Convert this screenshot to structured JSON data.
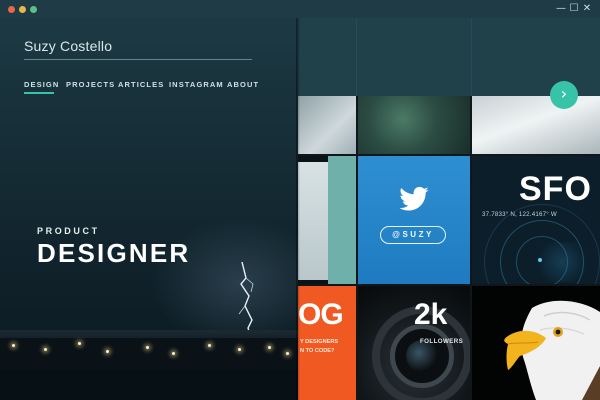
{
  "window": {
    "controls": {
      "minimize": "—",
      "maximize": "☐",
      "close": "✕"
    }
  },
  "header": {
    "name": "Suzy Costello",
    "nav": [
      {
        "label": "DESIGN",
        "active": true
      },
      {
        "label": "PROJECTS",
        "active": false
      },
      {
        "label": "ARTICLES",
        "active": false
      },
      {
        "label": "INSTAGRAM",
        "active": false
      },
      {
        "label": "ABOUT",
        "active": false
      }
    ],
    "next_icon": "›"
  },
  "hero": {
    "kicker": "PRODUCT",
    "title": "DESIGNER"
  },
  "tiles": {
    "twitter": {
      "handle": "@SUZY",
      "icon": "twitter-bird-icon"
    },
    "sfo": {
      "title": "SFO",
      "coords": "37.7833° N, 122.4167° W"
    },
    "blog": {
      "partial_title": "OG",
      "subtitle_line1": "Y DESIGNERS",
      "subtitle_line2": "N TO CODE?"
    },
    "followers": {
      "count": "2k",
      "label": "FOLLOWERS"
    }
  },
  "colors": {
    "accent": "#37c3a8",
    "twitter": "#2d8fd1",
    "orange": "#f05a22",
    "titlebar": "#1f3b45"
  }
}
